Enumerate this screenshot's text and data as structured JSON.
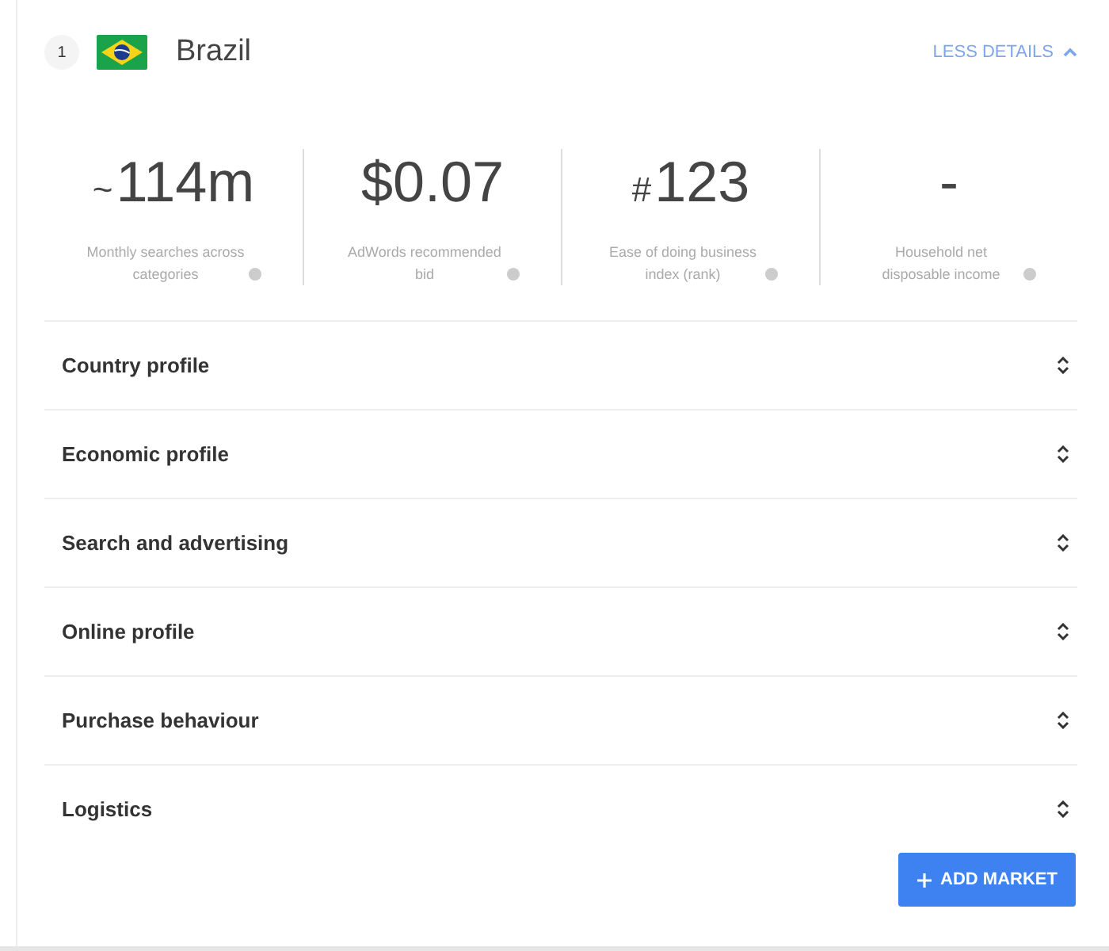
{
  "market": {
    "rank": "1",
    "country": "Brazil",
    "toggle": {
      "label": "LESS DETAILS",
      "expanded": true
    }
  },
  "stats": [
    {
      "prefix": "~",
      "value": "114m",
      "label": "Monthly searches across categories"
    },
    {
      "value": "$0.07",
      "label": "AdWords recommended bid"
    },
    {
      "prefix": "#",
      "value": "123",
      "label": "Ease of doing business index (rank)"
    },
    {
      "value": "-",
      "label": "Household net disposable income"
    }
  ],
  "sections": [
    "Country profile",
    "Economic profile",
    "Search and advertising",
    "Online profile",
    "Purchase behaviour",
    "Logistics"
  ],
  "add_button": {
    "label": "ADD MARKET"
  }
}
